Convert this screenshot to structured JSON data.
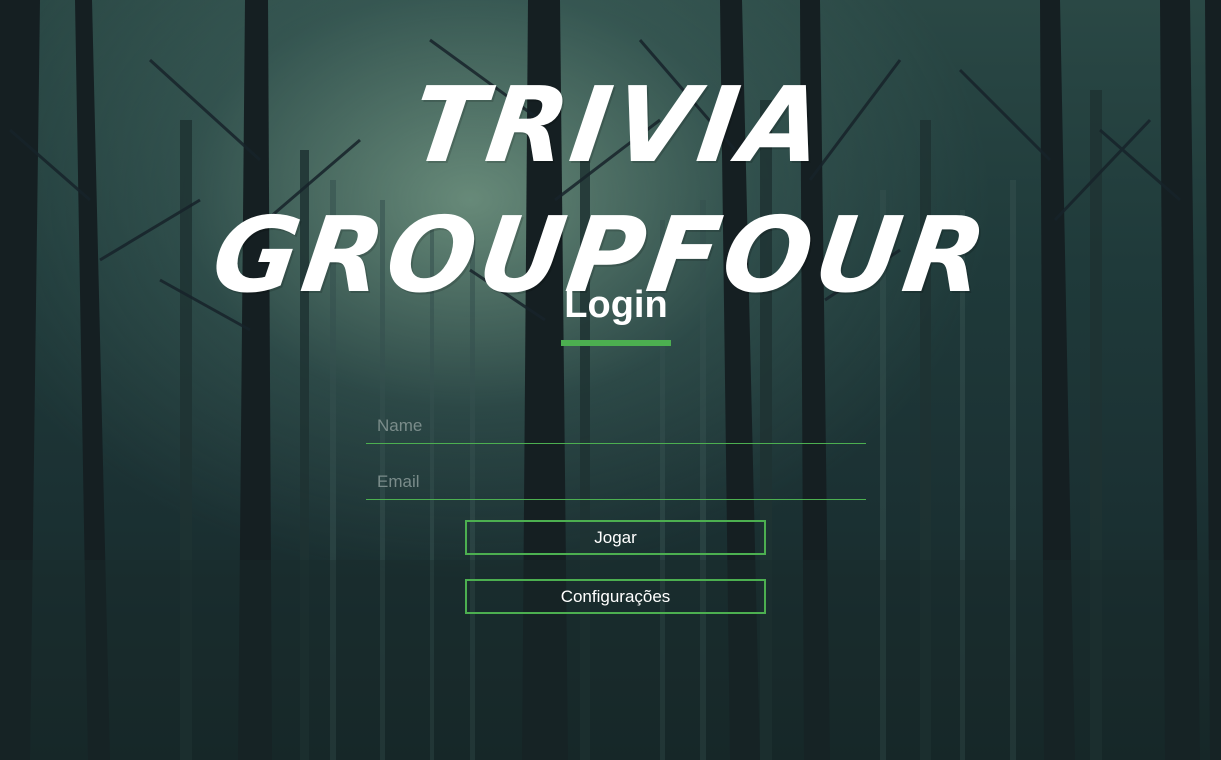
{
  "header": {
    "title": "Trivia GroupFour"
  },
  "login": {
    "heading": "Login",
    "name_placeholder": "Name",
    "email_placeholder": "Email",
    "play_label": "Jogar",
    "settings_label": "Configurações"
  },
  "theme": {
    "accent": "#4caf50",
    "text": "#ffffff",
    "background": "#1f3a3a"
  }
}
